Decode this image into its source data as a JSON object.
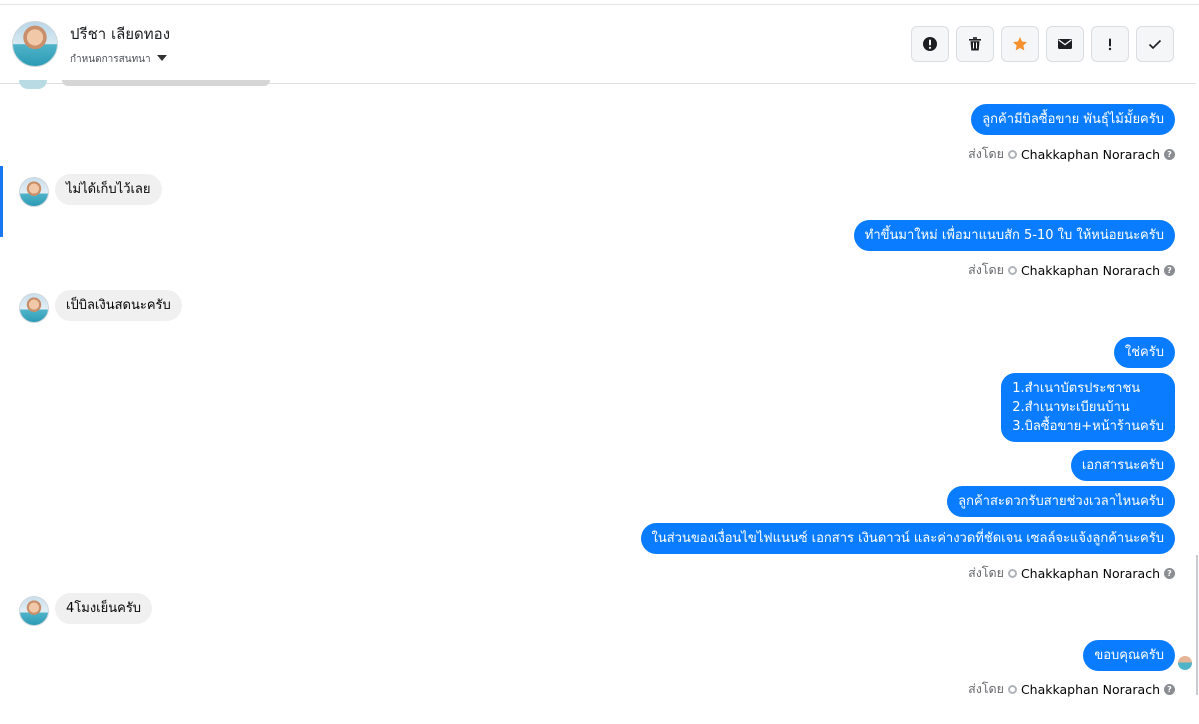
{
  "header": {
    "name": "ปรีชา เลียดทอง",
    "subtitle": "กำหนดการสนทนา"
  },
  "toolbar": {
    "buttons": [
      {
        "icon": "alert-circle-icon",
        "color": "#1c1e21"
      },
      {
        "icon": "trash-icon",
        "color": "#1c1e21"
      },
      {
        "icon": "star-icon",
        "color": "#f5922f"
      },
      {
        "icon": "mail-icon",
        "color": "#1c1e21"
      },
      {
        "icon": "exclamation-icon",
        "color": "#1c1e21"
      },
      {
        "icon": "check-icon",
        "color": "#1c1e21"
      }
    ]
  },
  "messages": {
    "m1": "ลูกค้ามีบิลซื้อขาย พันธุ์ไม้มั้ยครับ",
    "m2": "ไม่ได้เก็บไว้เลย",
    "m3": "ทำขึ้นมาใหม่ เพื่อมาแนบสัก 5-10 ใบ ให้หน่อยนะครับ",
    "m4": "เป็บิลเงินสดนะครับ",
    "m5": "ใช่ครับ",
    "m6": "1.สำเนาบัตรประชาชน\n2.สำเนาทะเบียนบ้าน\n3.บิลซื้อขาย+หน้าร้านครับ",
    "m7": "เอกสารนะครับ",
    "m8": "ลูกค้าสะดวกรับสายช่วงเวลาไหนครับ",
    "m9": "ในส่วนของเงื่อนไขไฟแนนซ์ เอกสาร เงินดาวน์ และค่างวดที่ชัดเจน เซลล์จะแจ้งลูกค้านะครับ",
    "m10": "4โมงเย็นครับ",
    "m11": "ขอบคุณครับ"
  },
  "sent_by": {
    "label": "ส่งโดย",
    "sender": "Chakkaphan Norarach",
    "help": "?"
  },
  "colors": {
    "outgoing": "#0a7cff",
    "incoming": "#f0f0f0",
    "accent": "#1877f2"
  }
}
